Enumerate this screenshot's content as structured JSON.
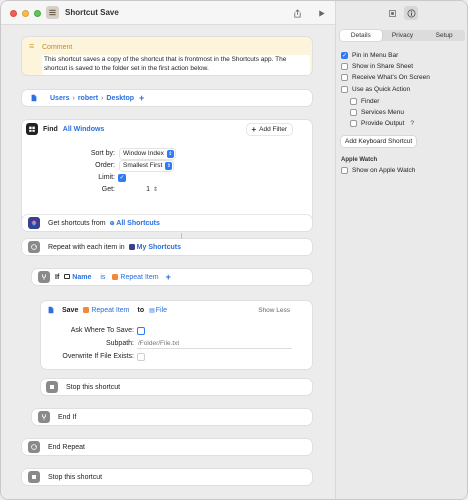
{
  "window": {
    "title": "Shortcut Save",
    "icons": {
      "app": "shortcut-icon",
      "share": "share-icon",
      "run": "play-icon",
      "library": "library-icon",
      "info": "info-icon"
    }
  },
  "comment": {
    "title": "Comment",
    "body": "This shortcut saves a copy of the shortcut that is frontmost in the Shortcuts app. The shortcut is saved to the folder set in the first action below."
  },
  "folder": {
    "path": [
      "Users",
      "robert",
      "Desktop"
    ],
    "separator": "›",
    "plus": "+"
  },
  "find": {
    "label": "Find",
    "target": "All Windows",
    "add_filter": "Add Filter",
    "sort_by_label": "Sort by:",
    "sort_by_value": "Window Index",
    "order_label": "Order:",
    "order_value": "Smallest First",
    "limit_label": "Limit:",
    "limit_checked": true,
    "get_label": "Get:",
    "get_value": "1"
  },
  "get_shortcuts": {
    "label": "Get shortcuts from",
    "source": "All Shortcuts"
  },
  "repeat": {
    "label": "Repeat with each item in",
    "source": "My Shortcuts"
  },
  "if_block": {
    "label": "If",
    "field": "Name",
    "operator": "is",
    "value": "Repeat Item",
    "plus": "+"
  },
  "save": {
    "label": "Save",
    "item": "Repeat Item",
    "to": "to",
    "destination": "File",
    "show_less": "Show Less",
    "ask_label": "Ask Where To Save:",
    "ask_checked": false,
    "subpath_label": "Subpath:",
    "subpath_placeholder": "/Folder/File.txt",
    "overwrite_label": "Overwrite If File Exists:",
    "overwrite_checked": false
  },
  "stop_inner": {
    "label": "Stop this shortcut"
  },
  "end_if": {
    "label": "End If"
  },
  "end_repeat": {
    "label": "End Repeat"
  },
  "stop_outer": {
    "label": "Stop this shortcut"
  },
  "sidebar": {
    "tabs": [
      "Details",
      "Privacy",
      "Setup"
    ],
    "active_tab": "Details",
    "options": [
      {
        "label": "Pin in Menu Bar",
        "checked": true
      },
      {
        "label": "Show in Share Sheet",
        "checked": false
      },
      {
        "label": "Receive What's On Screen",
        "checked": false
      },
      {
        "label": "Use as Quick Action",
        "checked": false
      }
    ],
    "quick_action_options": [
      {
        "label": "Finder",
        "checked": false
      },
      {
        "label": "Services Menu",
        "checked": false
      },
      {
        "label": "Provide Output",
        "checked": false,
        "help": "?"
      }
    ],
    "keyboard_button": "Add Keyboard Shortcut",
    "watch_header": "Apple Watch",
    "watch_option": {
      "label": "Show on Apple Watch",
      "checked": false
    }
  },
  "colors": {
    "accent": "#2f7bf5",
    "comment_bg": "#fdf4dc",
    "comment_title": "#c98a1e",
    "files_icon": "#2e6fe0",
    "scripting_icon": "#8a8a8a",
    "shortcuts_icon": "#3a3f8f"
  }
}
